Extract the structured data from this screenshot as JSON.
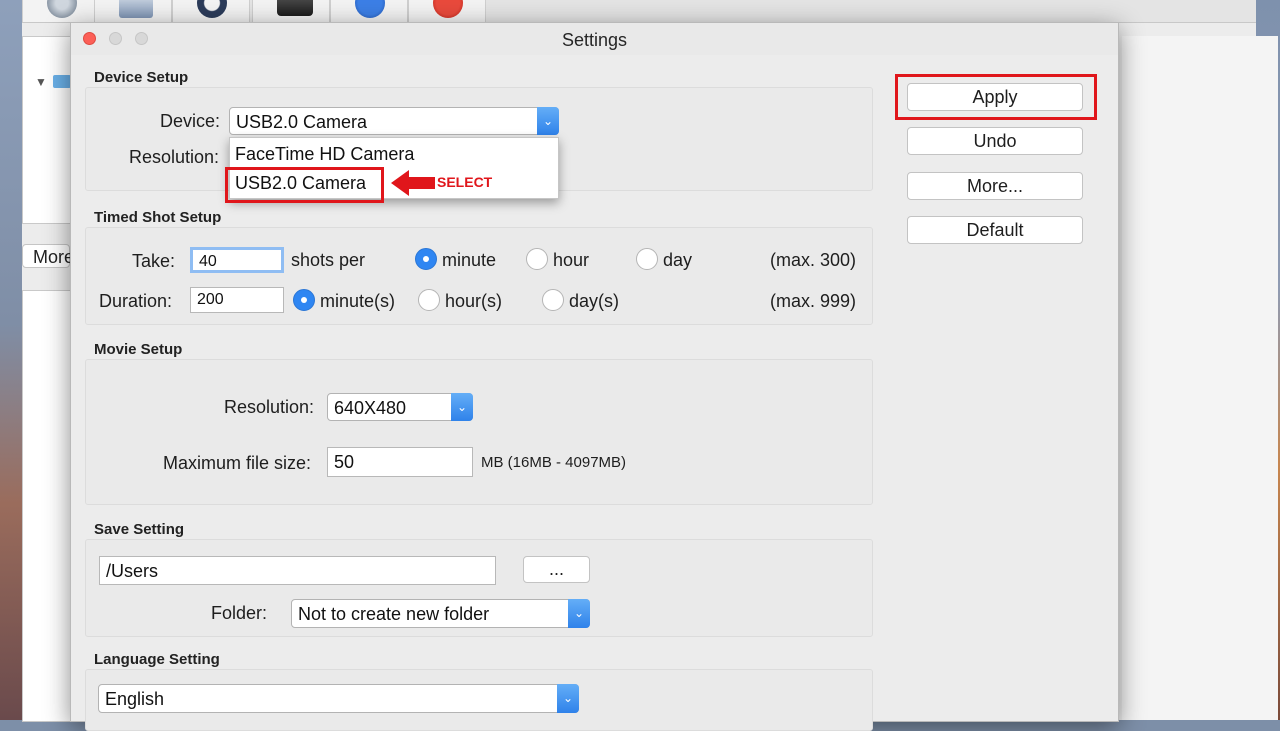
{
  "app": {
    "toolbar_icons": [
      "gear-icon",
      "scanner-icon",
      "clock-icon",
      "camera-icon",
      "help-icon",
      "power-icon"
    ],
    "more_label": "More"
  },
  "dialog": {
    "title": "Settings",
    "device_setup": {
      "heading": "Device Setup",
      "device_label": "Device:",
      "device_value": "USB2.0 Camera",
      "resolution_label": "Resolution:",
      "dropdown_options": [
        "FaceTime HD Camera",
        "USB2.0 Camera"
      ],
      "annotation": "SELECT"
    },
    "timed_shot": {
      "heading": "Timed Shot Setup",
      "take_label": "Take:",
      "take_value": "40",
      "shots_per_label": "shots per",
      "take_units": [
        "minute",
        "hour",
        "day"
      ],
      "take_selected": "minute",
      "take_max": "(max. 300)",
      "duration_label": "Duration:",
      "duration_value": "200",
      "duration_units": [
        "minute(s)",
        "hour(s)",
        "day(s)"
      ],
      "duration_selected": "minute(s)",
      "duration_max": "(max. 999)"
    },
    "movie_setup": {
      "heading": "Movie Setup",
      "resolution_label": "Resolution:",
      "resolution_value": "640X480",
      "max_size_label": "Maximum file size:",
      "max_size_value": "50",
      "max_size_hint": "MB (16MB - 4097MB)"
    },
    "save_setting": {
      "heading": "Save Setting",
      "path_value": "/Users",
      "browse_label": "...",
      "folder_label": "Folder:",
      "folder_value": "Not to create new folder"
    },
    "language_setting": {
      "heading": "Language Setting",
      "language_value": "English"
    },
    "buttons": {
      "apply": "Apply",
      "undo": "Undo",
      "more": "More...",
      "default": "Default"
    },
    "colors": {
      "highlight": "#e0161b",
      "accent": "#2f86f2"
    }
  }
}
